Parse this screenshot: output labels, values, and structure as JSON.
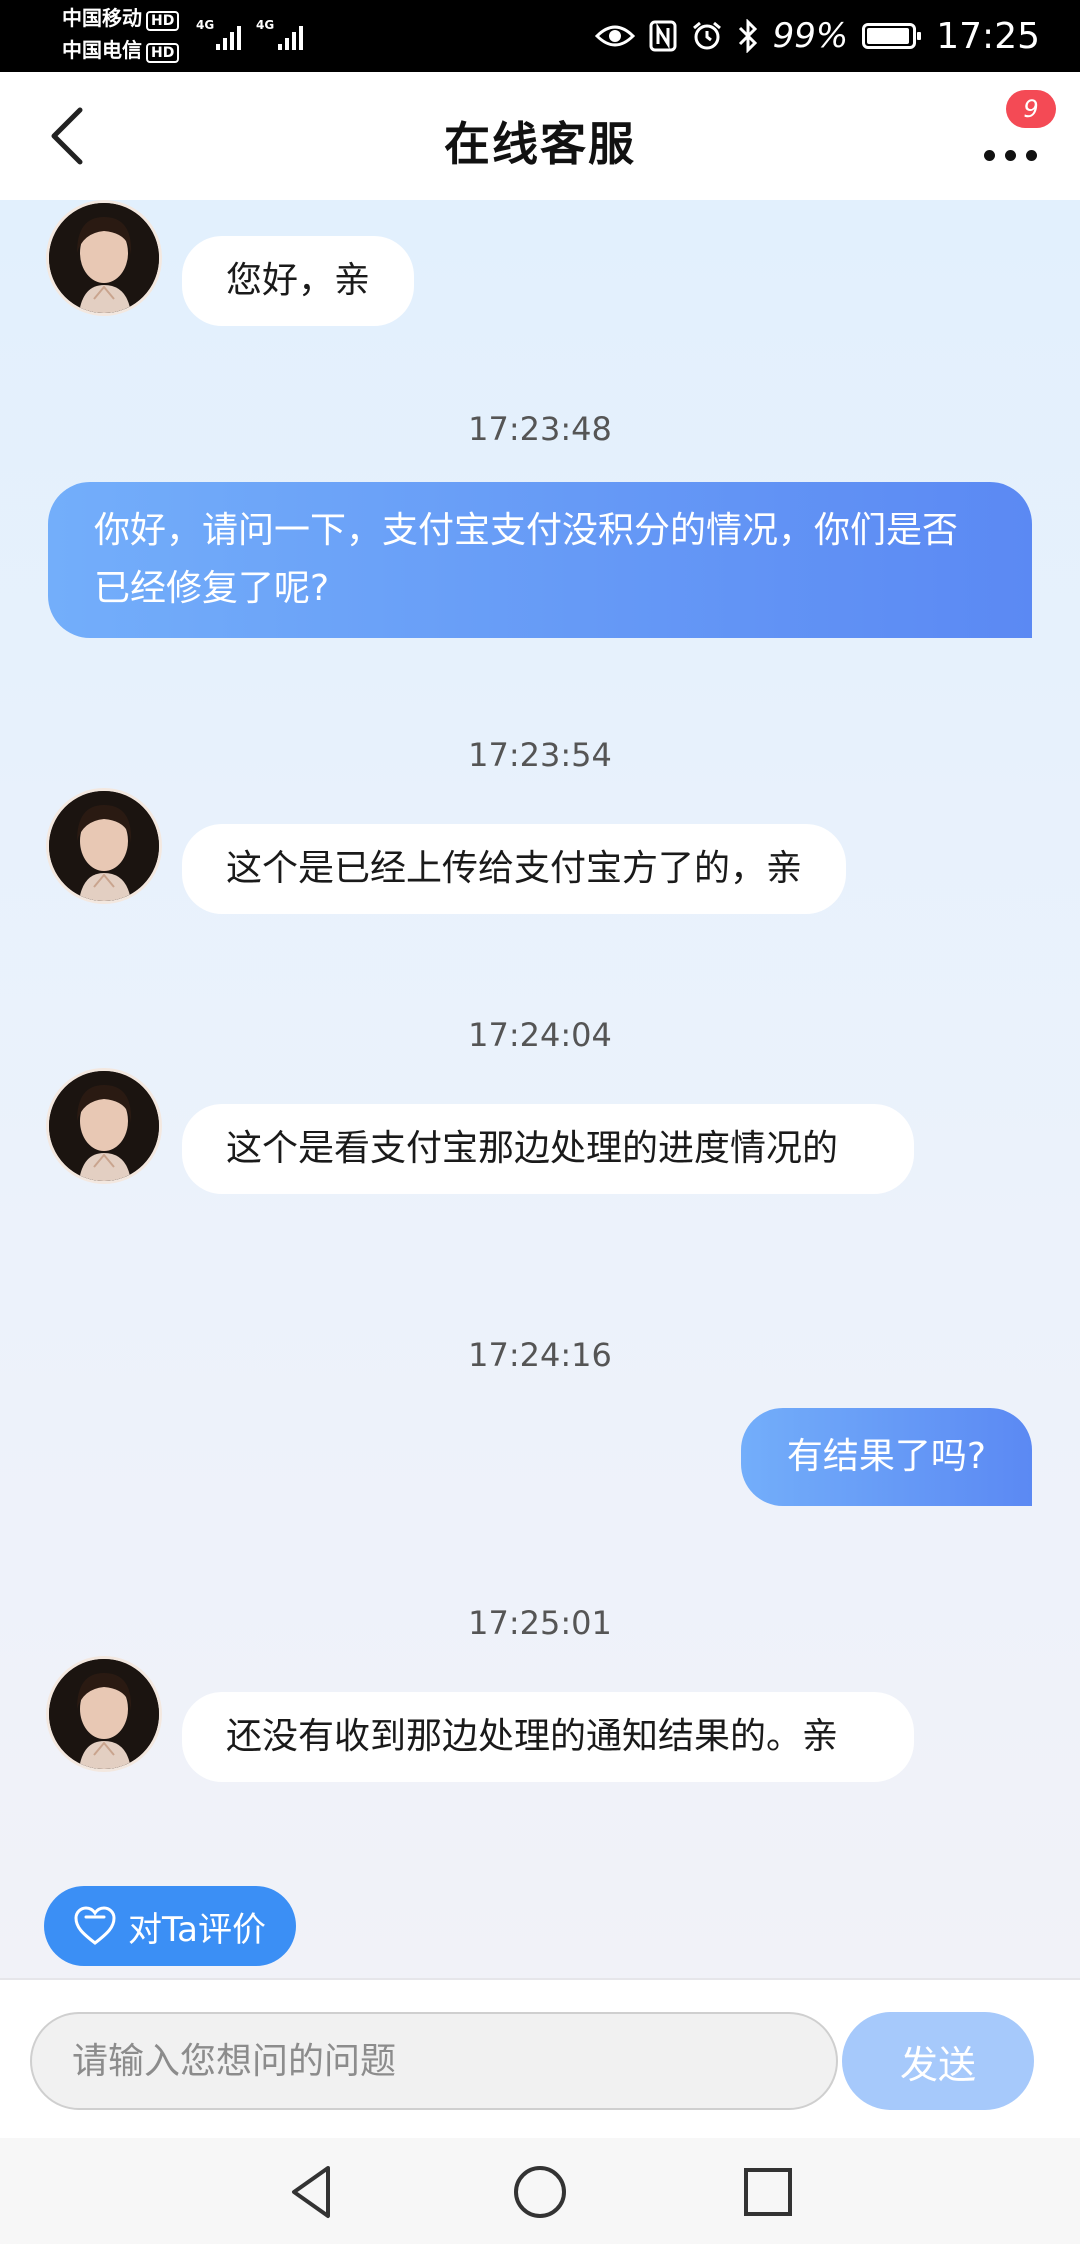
{
  "status_bar": {
    "carrier1": "中国移动",
    "carrier2": "中国电信",
    "hd_label": "HD",
    "network1": "4G",
    "network2": "4G",
    "battery_percent": "99%",
    "battery_level": 0.99,
    "time": "17:25"
  },
  "header": {
    "title": "在线客服",
    "badge_count": "9"
  },
  "messages": [
    {
      "from": "agent",
      "text": "您好，亲"
    },
    {
      "from": "timestamp",
      "text": "17:23:48"
    },
    {
      "from": "user",
      "text": "你好，请问一下，支付宝支付没积分的情况，你们是否已经修复了呢?"
    },
    {
      "from": "timestamp",
      "text": "17:23:54"
    },
    {
      "from": "agent",
      "text": "这个是已经上传给支付宝方了的，亲"
    },
    {
      "from": "timestamp",
      "text": "17:24:04"
    },
    {
      "from": "agent",
      "text": "这个是看支付宝那边处理的进度情况的"
    },
    {
      "from": "timestamp",
      "text": "17:24:16"
    },
    {
      "from": "user",
      "text": "有结果了吗?"
    },
    {
      "from": "timestamp",
      "text": "17:25:01"
    },
    {
      "from": "agent",
      "text": "还没有收到那边处理的通知结果的。亲"
    }
  ],
  "rate_button": {
    "label": "对Ta评价"
  },
  "input": {
    "placeholder": "请输入您想问的问题",
    "value": ""
  },
  "send_button": {
    "label": "发送"
  },
  "colors": {
    "accent": "#3b8ff5",
    "user_bubble_start": "#73aefa",
    "user_bubble_end": "#5b89f3",
    "badge": "#f44a55",
    "send_disabled": "#a6c9fb"
  }
}
